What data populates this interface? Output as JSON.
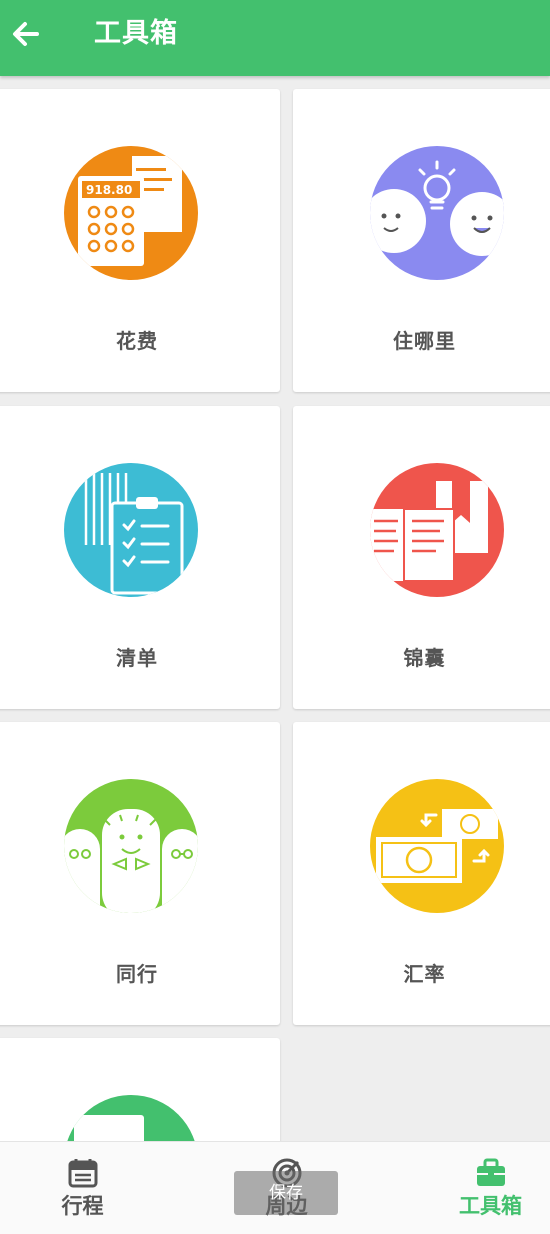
{
  "header": {
    "title": "工具箱",
    "back_icon": "arrow-left-icon"
  },
  "tools": [
    {
      "label": "花费",
      "icon": "calculator-receipt-icon",
      "color": "#ef8a14",
      "amount": "918.80"
    },
    {
      "label": "住哪里",
      "icon": "lightbulb-faces-icon",
      "color": "#8a8af0"
    },
    {
      "label": "清单",
      "icon": "clipboard-checklist-icon",
      "color": "#3dbcd4"
    },
    {
      "label": "锦囊",
      "icon": "open-book-icon",
      "color": "#ef554c"
    },
    {
      "label": "同行",
      "icon": "companions-icon",
      "color": "#7ccb3c"
    },
    {
      "label": "汇率",
      "icon": "currency-exchange-icon",
      "color": "#f5c115"
    },
    {
      "label": "",
      "icon": "partial-tool-icon",
      "color": "#43c06e"
    }
  ],
  "bottom_nav": [
    {
      "label": "行程",
      "icon": "calendar-icon",
      "active": false
    },
    {
      "label": "周边",
      "icon": "radar-icon",
      "active": false
    },
    {
      "label": "工具箱",
      "icon": "toolbox-icon",
      "active": true
    }
  ],
  "toast": "保存",
  "colors": {
    "accent": "#43c06e",
    "nav_inactive": "#555555"
  }
}
